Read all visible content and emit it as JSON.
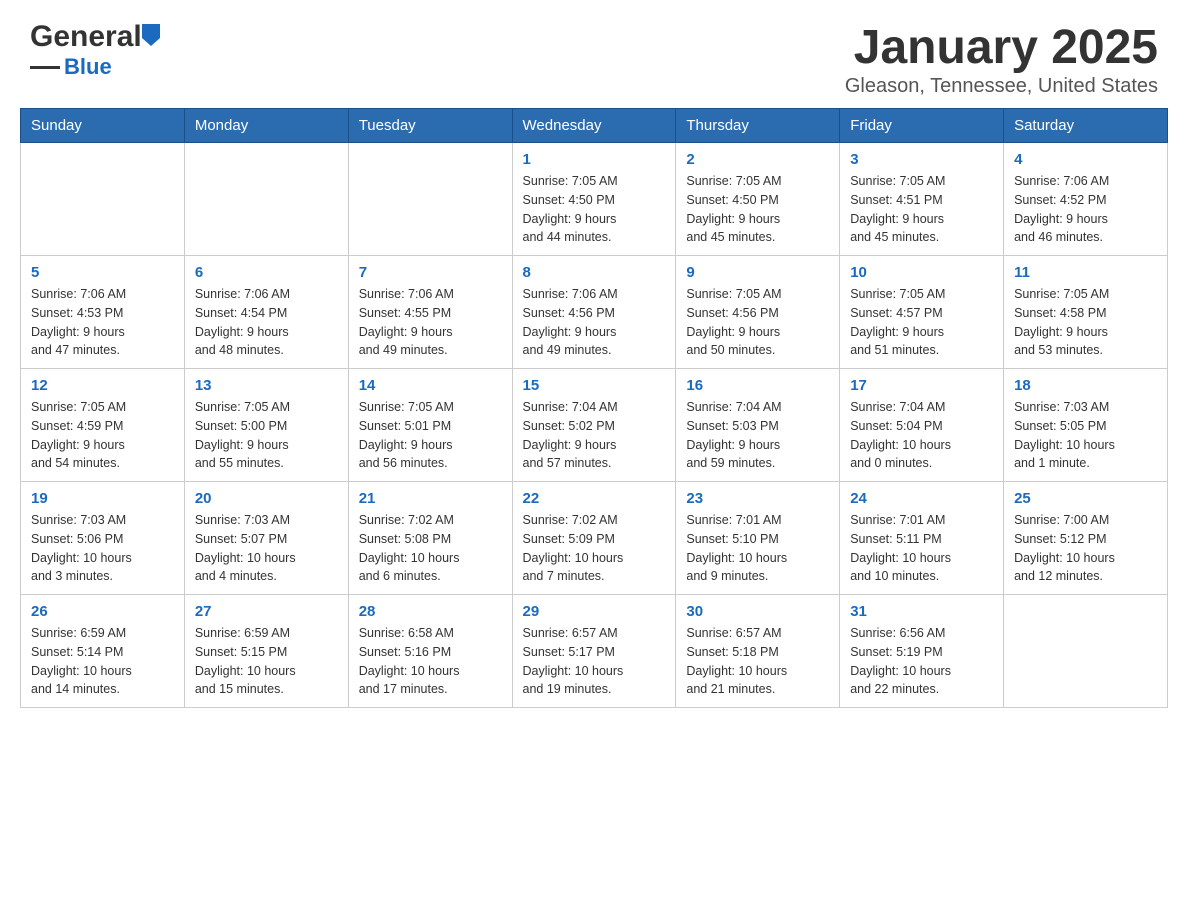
{
  "header": {
    "logo": {
      "general": "General",
      "blue": "Blue"
    },
    "title": "January 2025",
    "subtitle": "Gleason, Tennessee, United States"
  },
  "calendar": {
    "days_of_week": [
      "Sunday",
      "Monday",
      "Tuesday",
      "Wednesday",
      "Thursday",
      "Friday",
      "Saturday"
    ],
    "weeks": [
      [
        {
          "day": "",
          "info": ""
        },
        {
          "day": "",
          "info": ""
        },
        {
          "day": "",
          "info": ""
        },
        {
          "day": "1",
          "info": "Sunrise: 7:05 AM\nSunset: 4:50 PM\nDaylight: 9 hours\nand 44 minutes."
        },
        {
          "day": "2",
          "info": "Sunrise: 7:05 AM\nSunset: 4:50 PM\nDaylight: 9 hours\nand 45 minutes."
        },
        {
          "day": "3",
          "info": "Sunrise: 7:05 AM\nSunset: 4:51 PM\nDaylight: 9 hours\nand 45 minutes."
        },
        {
          "day": "4",
          "info": "Sunrise: 7:06 AM\nSunset: 4:52 PM\nDaylight: 9 hours\nand 46 minutes."
        }
      ],
      [
        {
          "day": "5",
          "info": "Sunrise: 7:06 AM\nSunset: 4:53 PM\nDaylight: 9 hours\nand 47 minutes."
        },
        {
          "day": "6",
          "info": "Sunrise: 7:06 AM\nSunset: 4:54 PM\nDaylight: 9 hours\nand 48 minutes."
        },
        {
          "day": "7",
          "info": "Sunrise: 7:06 AM\nSunset: 4:55 PM\nDaylight: 9 hours\nand 49 minutes."
        },
        {
          "day": "8",
          "info": "Sunrise: 7:06 AM\nSunset: 4:56 PM\nDaylight: 9 hours\nand 49 minutes."
        },
        {
          "day": "9",
          "info": "Sunrise: 7:05 AM\nSunset: 4:56 PM\nDaylight: 9 hours\nand 50 minutes."
        },
        {
          "day": "10",
          "info": "Sunrise: 7:05 AM\nSunset: 4:57 PM\nDaylight: 9 hours\nand 51 minutes."
        },
        {
          "day": "11",
          "info": "Sunrise: 7:05 AM\nSunset: 4:58 PM\nDaylight: 9 hours\nand 53 minutes."
        }
      ],
      [
        {
          "day": "12",
          "info": "Sunrise: 7:05 AM\nSunset: 4:59 PM\nDaylight: 9 hours\nand 54 minutes."
        },
        {
          "day": "13",
          "info": "Sunrise: 7:05 AM\nSunset: 5:00 PM\nDaylight: 9 hours\nand 55 minutes."
        },
        {
          "day": "14",
          "info": "Sunrise: 7:05 AM\nSunset: 5:01 PM\nDaylight: 9 hours\nand 56 minutes."
        },
        {
          "day": "15",
          "info": "Sunrise: 7:04 AM\nSunset: 5:02 PM\nDaylight: 9 hours\nand 57 minutes."
        },
        {
          "day": "16",
          "info": "Sunrise: 7:04 AM\nSunset: 5:03 PM\nDaylight: 9 hours\nand 59 minutes."
        },
        {
          "day": "17",
          "info": "Sunrise: 7:04 AM\nSunset: 5:04 PM\nDaylight: 10 hours\nand 0 minutes."
        },
        {
          "day": "18",
          "info": "Sunrise: 7:03 AM\nSunset: 5:05 PM\nDaylight: 10 hours\nand 1 minute."
        }
      ],
      [
        {
          "day": "19",
          "info": "Sunrise: 7:03 AM\nSunset: 5:06 PM\nDaylight: 10 hours\nand 3 minutes."
        },
        {
          "day": "20",
          "info": "Sunrise: 7:03 AM\nSunset: 5:07 PM\nDaylight: 10 hours\nand 4 minutes."
        },
        {
          "day": "21",
          "info": "Sunrise: 7:02 AM\nSunset: 5:08 PM\nDaylight: 10 hours\nand 6 minutes."
        },
        {
          "day": "22",
          "info": "Sunrise: 7:02 AM\nSunset: 5:09 PM\nDaylight: 10 hours\nand 7 minutes."
        },
        {
          "day": "23",
          "info": "Sunrise: 7:01 AM\nSunset: 5:10 PM\nDaylight: 10 hours\nand 9 minutes."
        },
        {
          "day": "24",
          "info": "Sunrise: 7:01 AM\nSunset: 5:11 PM\nDaylight: 10 hours\nand 10 minutes."
        },
        {
          "day": "25",
          "info": "Sunrise: 7:00 AM\nSunset: 5:12 PM\nDaylight: 10 hours\nand 12 minutes."
        }
      ],
      [
        {
          "day": "26",
          "info": "Sunrise: 6:59 AM\nSunset: 5:14 PM\nDaylight: 10 hours\nand 14 minutes."
        },
        {
          "day": "27",
          "info": "Sunrise: 6:59 AM\nSunset: 5:15 PM\nDaylight: 10 hours\nand 15 minutes."
        },
        {
          "day": "28",
          "info": "Sunrise: 6:58 AM\nSunset: 5:16 PM\nDaylight: 10 hours\nand 17 minutes."
        },
        {
          "day": "29",
          "info": "Sunrise: 6:57 AM\nSunset: 5:17 PM\nDaylight: 10 hours\nand 19 minutes."
        },
        {
          "day": "30",
          "info": "Sunrise: 6:57 AM\nSunset: 5:18 PM\nDaylight: 10 hours\nand 21 minutes."
        },
        {
          "day": "31",
          "info": "Sunrise: 6:56 AM\nSunset: 5:19 PM\nDaylight: 10 hours\nand 22 minutes."
        },
        {
          "day": "",
          "info": ""
        }
      ]
    ]
  }
}
